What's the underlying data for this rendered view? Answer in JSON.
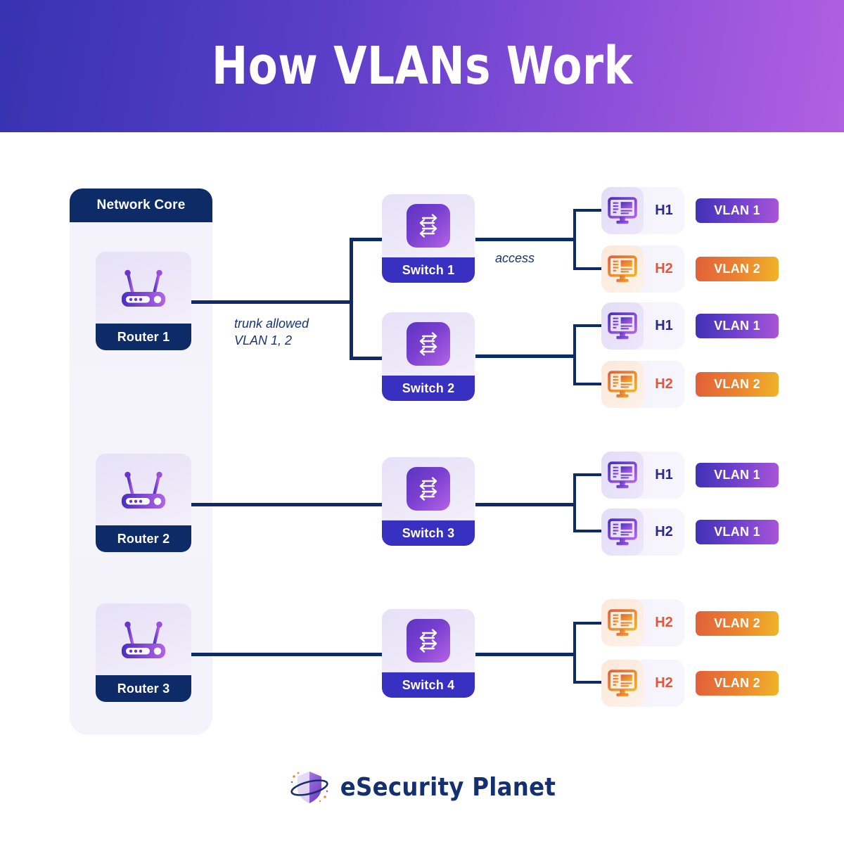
{
  "header": {
    "title": "How VLANs Work"
  },
  "core": {
    "badge_label": "Network Core"
  },
  "edges": {
    "trunk_line1": "trunk allowed",
    "trunk_line2": "VLAN 1, 2",
    "access_label": "access"
  },
  "routers": [
    {
      "id": "router-1",
      "label": "Router 1",
      "icon": "router-icon"
    },
    {
      "id": "router-2",
      "label": "Router 2",
      "icon": "router-icon"
    },
    {
      "id": "router-3",
      "label": "Router 3",
      "icon": "router-icon"
    }
  ],
  "switches": [
    {
      "id": "switch-1",
      "label": "Switch 1",
      "icon": "switch-arrows-icon"
    },
    {
      "id": "switch-2",
      "label": "Switch 2",
      "icon": "switch-arrows-icon"
    },
    {
      "id": "switch-3",
      "label": "Switch 3",
      "icon": "switch-arrows-icon"
    },
    {
      "id": "switch-4",
      "label": "Switch 4",
      "icon": "switch-arrows-icon"
    }
  ],
  "hosts": [
    {
      "id": "h-s1-1",
      "label": "H1",
      "vlan": "VLAN 1",
      "theme": "v1",
      "icon": "monitor-icon"
    },
    {
      "id": "h-s1-2",
      "label": "H2",
      "vlan": "VLAN 2",
      "theme": "v2",
      "icon": "monitor-icon"
    },
    {
      "id": "h-s2-1",
      "label": "H1",
      "vlan": "VLAN 1",
      "theme": "v1",
      "icon": "monitor-icon"
    },
    {
      "id": "h-s2-2",
      "label": "H2",
      "vlan": "VLAN 2",
      "theme": "v2",
      "icon": "monitor-icon"
    },
    {
      "id": "h-s3-1",
      "label": "H1",
      "vlan": "VLAN 1",
      "theme": "v1",
      "icon": "monitor-icon"
    },
    {
      "id": "h-s3-2",
      "label": "H2",
      "vlan": "VLAN 1",
      "theme": "v1",
      "icon": "monitor-icon"
    },
    {
      "id": "h-s4-1",
      "label": "H2",
      "vlan": "VLAN 2",
      "theme": "v2",
      "icon": "monitor-icon"
    },
    {
      "id": "h-s4-2",
      "label": "H2",
      "vlan": "VLAN 2",
      "theme": "v2",
      "icon": "monitor-icon"
    }
  ],
  "footer": {
    "brand": "eSecurity Planet",
    "logo_icon": "shield-orbit-icon"
  },
  "colors": {
    "header_gradient_start": "#3632b0",
    "header_gradient_end": "#b260e2",
    "navy": "#0d2b66",
    "switch_label": "#3730c0",
    "vlan1_start": "#3f31b5",
    "vlan1_end": "#a855d8",
    "vlan2_start": "#e2603a",
    "vlan2_end": "#f0b429",
    "panel_bg": "#f4f2fa",
    "h1_text": "#2a2a8f",
    "h2_text": "#e4553a"
  }
}
